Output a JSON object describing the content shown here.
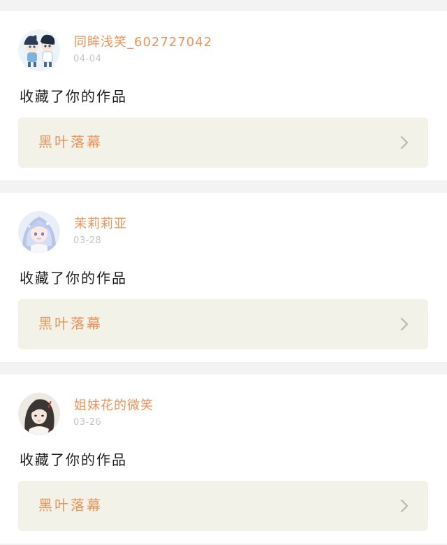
{
  "theme": {
    "accent": "#e8935a",
    "chevron": "#b8b8b0"
  },
  "notifications": [
    {
      "avatar_icon": "chibi-couple-avatar-icon",
      "username": "同眸浅笑_602727042",
      "date": "04-04",
      "action": "收藏了你的作品",
      "work_title": "黑叶落幕"
    },
    {
      "avatar_icon": "anime-girl-avatar-icon",
      "username": "茉莉莉亚",
      "date": "03-28",
      "action": "收藏了你的作品",
      "work_title": "黑叶落幕"
    },
    {
      "avatar_icon": "ancient-style-girl-avatar-icon",
      "username": "姐妹花的微笑",
      "date": "03-26",
      "action": "收藏了你的作品",
      "work_title": "黑叶落幕"
    }
  ]
}
